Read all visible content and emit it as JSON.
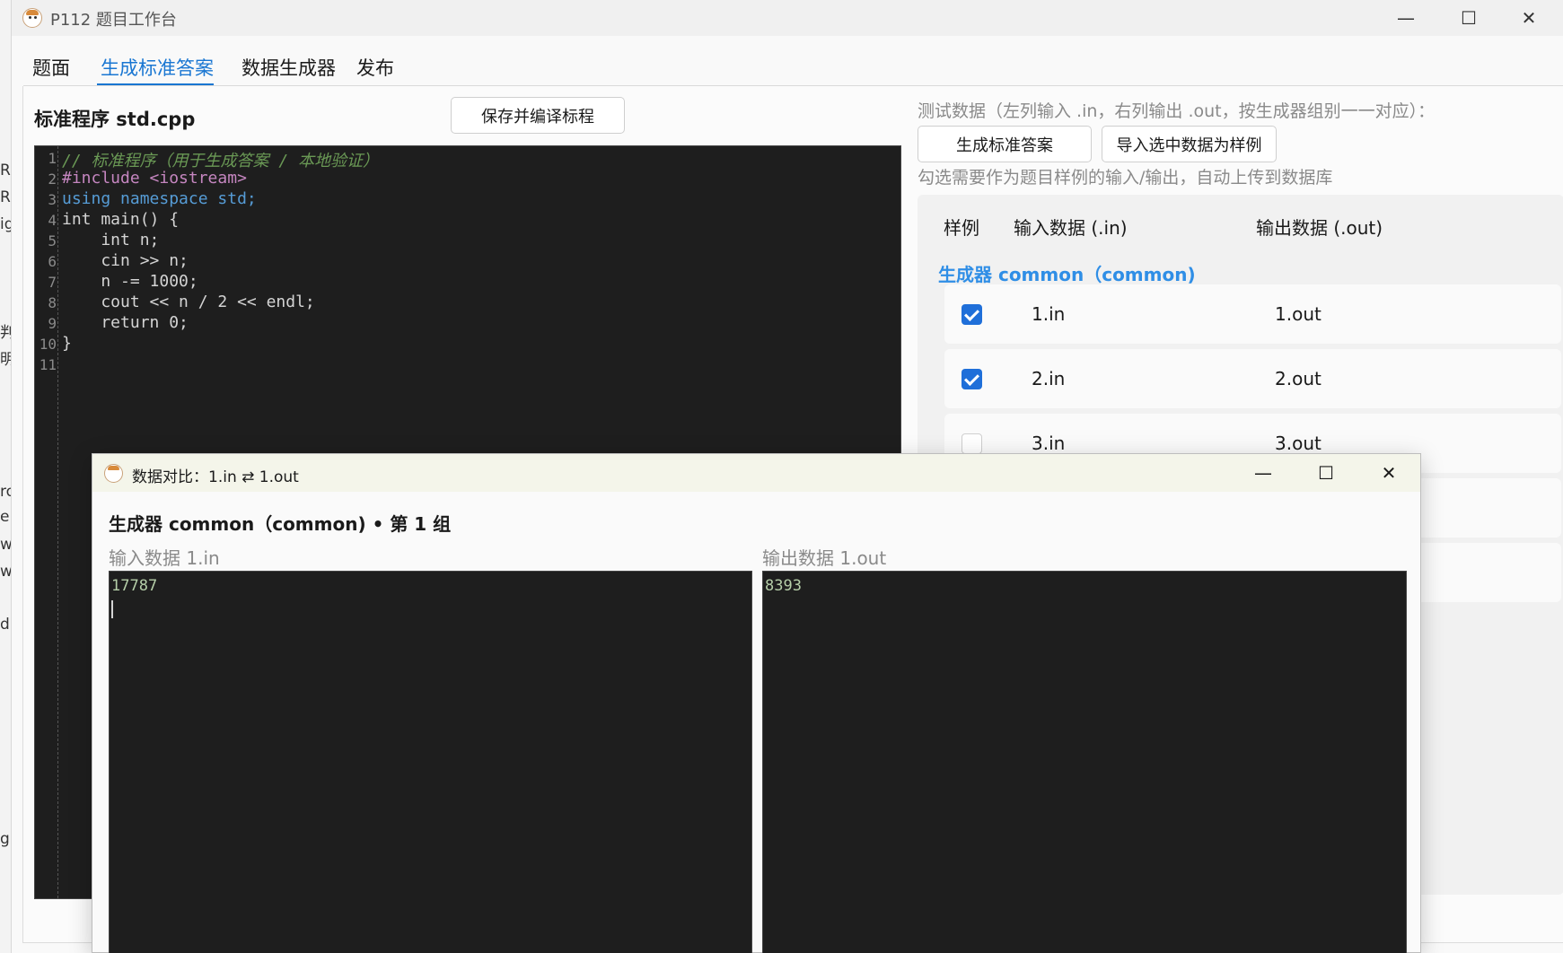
{
  "background_strip": {
    "chars": [
      "R",
      "R",
      "ig",
      "判",
      "明",
      "ro",
      "e.",
      "w",
      "w",
      "d",
      "gi"
    ]
  },
  "window": {
    "title": "P112 题目工作台",
    "minimize": "—",
    "maximize": "☐",
    "close": "✕"
  },
  "tabs": [
    {
      "label": "题面"
    },
    {
      "label": "生成标准答案"
    },
    {
      "label": "数据生成器"
    },
    {
      "label": "发布"
    }
  ],
  "editor": {
    "title": "标准程序 std.cpp",
    "save_button": "保存并编译标程",
    "line_numbers": [
      "1",
      "2",
      "3",
      "4",
      "5",
      "6",
      "7",
      "8",
      "9",
      "10",
      "11"
    ],
    "lines": [
      "// 标准程序（用于生成答案 / 本地验证）",
      "#include <iostream>",
      "using namespace std;",
      "int main() {",
      "    int n;",
      "    cin >> n;",
      "    n -= 1000;",
      "    cout << n / 2 << endl;",
      "    return 0;",
      "}",
      ""
    ]
  },
  "test_data": {
    "hint": "测试数据（左列输入 .in，右列输出 .out，按生成器组别一一对应）：",
    "generate_button": "生成标准答案",
    "import_button": "导入选中数据为样例",
    "sub_hint": "勾选需要作为题目样例的输入/输出，自动上传到数据库",
    "headers": {
      "sample": "样例",
      "input": "输入数据 (.in)",
      "output": "输出数据 (.out)"
    },
    "group": "生成器 common（common)",
    "rows": [
      {
        "checked": true,
        "in": "1.in",
        "out": "1.out"
      },
      {
        "checked": true,
        "in": "2.in",
        "out": "2.out"
      },
      {
        "checked": false,
        "in": "3.in",
        "out": "3.out"
      }
    ]
  },
  "dialog": {
    "title": "数据对比：1.in ⇄ 1.out",
    "heading": "生成器 common（common) • 第 1 组",
    "input_label": "输入数据 1.in",
    "output_label": "输出数据 1.out",
    "input_value": "17787",
    "output_value": "8393",
    "minimize": "—",
    "maximize": "☐",
    "close": "✕"
  }
}
